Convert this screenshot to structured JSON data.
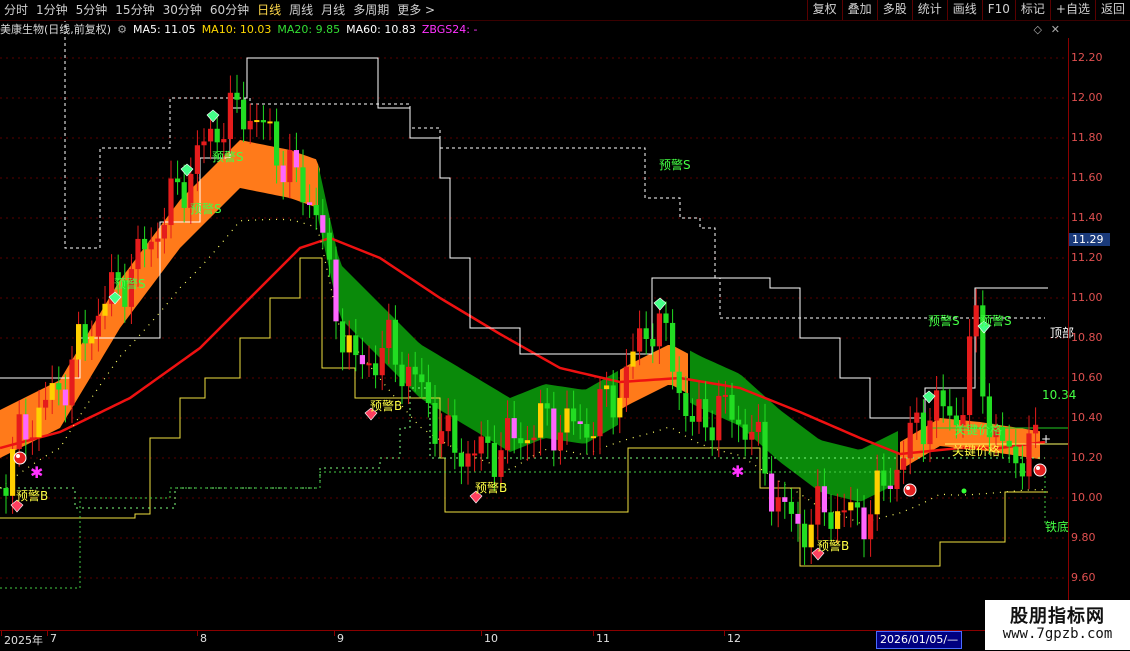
{
  "toolbar": {
    "periods": [
      "分时",
      "1分钟",
      "5分钟",
      "15分钟",
      "30分钟",
      "60分钟",
      "日线",
      "周线",
      "月线",
      "多周期",
      "更多 >"
    ],
    "active_period": "日线",
    "tools": [
      "复权",
      "叠加",
      "多股",
      "统计",
      "画线",
      "F10",
      "标记",
      "+自选",
      "返回"
    ]
  },
  "info": {
    "title": "美康生物(日线,前复权)",
    "ma5": "MA5: 11.05",
    "ma10": "MA10: 10.03",
    "ma20": "MA20: 9.85",
    "ma60": "MA60: 10.83",
    "indicator": "ZBGS24: -",
    "colors": {
      "title": "#d8d8d8",
      "ma5": "#ffffff",
      "ma10": "#ffd800",
      "ma20": "#33dd33",
      "ma60": "#ffffff",
      "indicator": "#ff33ff"
    }
  },
  "axis": {
    "price_ticks": [
      "12.20",
      "12.00",
      "11.80",
      "11.60",
      "11.40",
      "11.20",
      "11.00",
      "10.80",
      "10.60",
      "10.40",
      "10.20",
      "10.00",
      "9.80",
      "9.60"
    ],
    "current_price": "11.29",
    "x_labels": [
      "2025年",
      "7",
      "8",
      "9",
      "10",
      "11",
      "12"
    ],
    "crosshair_date": "2026/01/05/—"
  },
  "annotations": {
    "warn_s": "预警S",
    "warn_b": "预警B",
    "top": "顶部",
    "iron_bottom": "铁底",
    "key_price": "关键价格",
    "price_label": "10.34",
    "plus_marker": "+",
    "warn_b_diamond_color": "#ff4060",
    "warn_s_diamond_color": "#44ff88"
  },
  "watermark": {
    "line1": "股朋指标网",
    "line2": "www.7gpzb.com"
  }
}
